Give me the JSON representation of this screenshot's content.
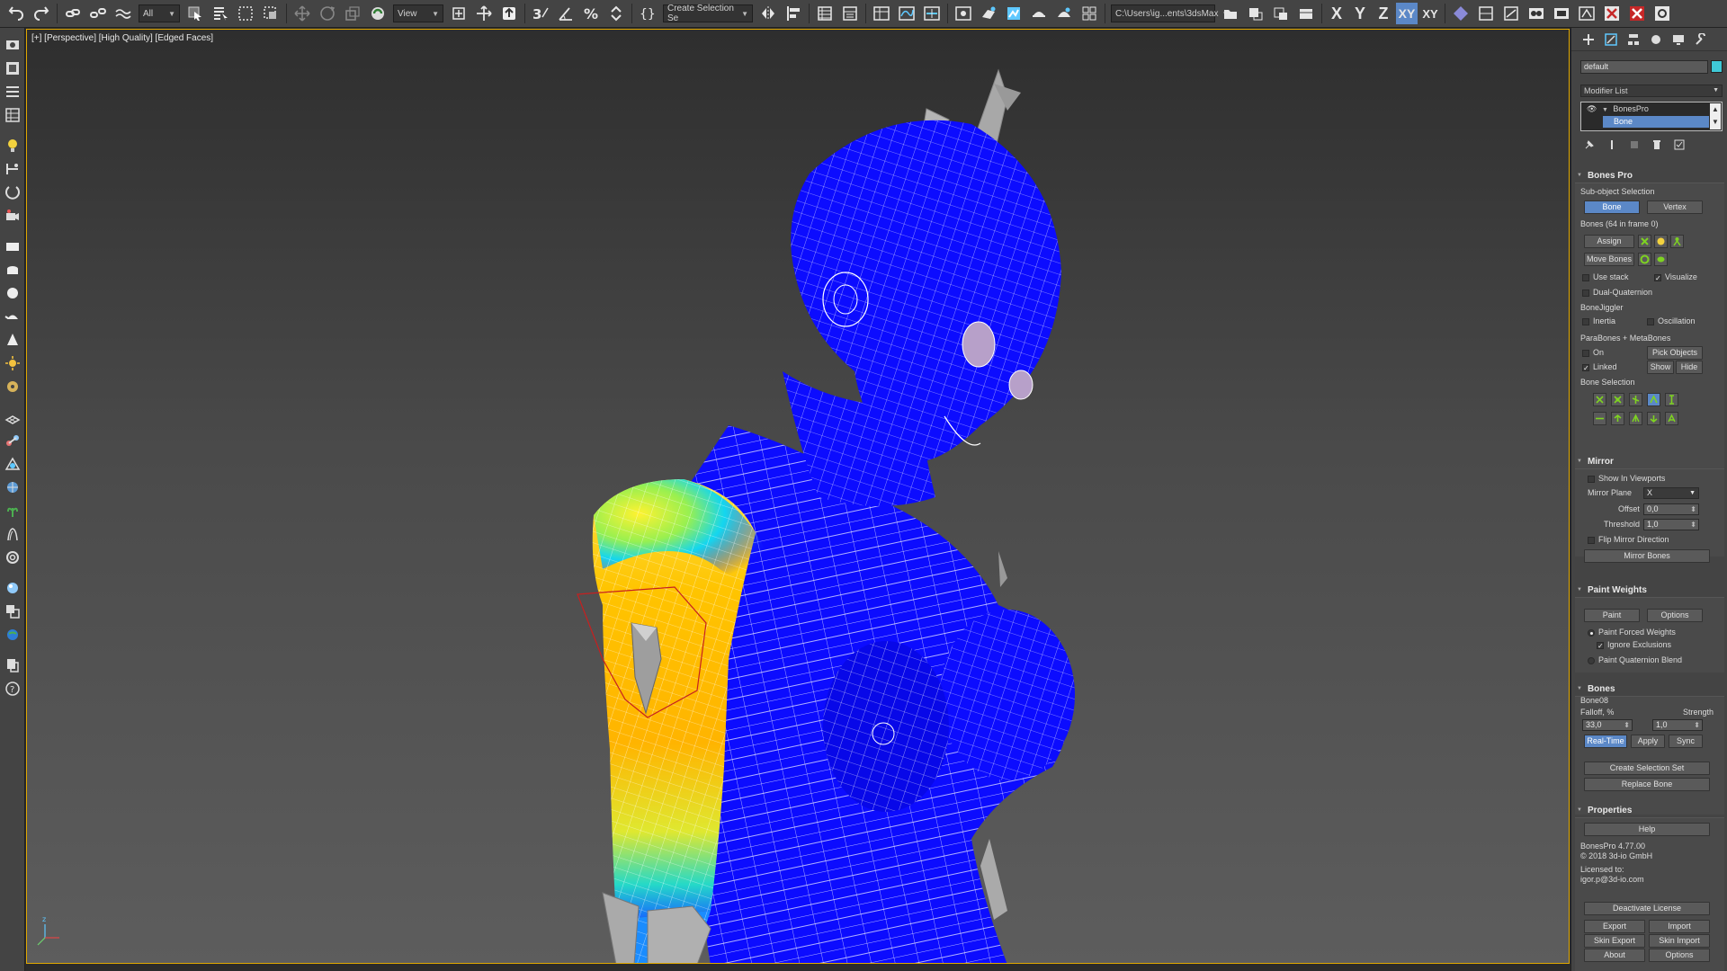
{
  "toolbar": {
    "selection_filter": "All",
    "ref_coord": "View",
    "named_selection": "Create Selection Se",
    "project_path": "C:\\Users\\ig...ents\\3dsMax",
    "axis_x": "X",
    "axis_y": "Y",
    "axis_z": "Z",
    "axis_xy": "XY",
    "axis_xy_cycle": "XY"
  },
  "viewport": {
    "label": "[+] [Perspective] [High Quality] [Edged Faces]",
    "axis_z": "z"
  },
  "panel": {
    "object_name": "default",
    "object_color": "#3fc9d7",
    "modifier_list": "Modifier List",
    "stack": [
      {
        "label": "BonesPro"
      },
      {
        "label": "Bone"
      }
    ],
    "bones_pro": {
      "title": "Bones Pro",
      "subobject_label": "Sub-object Selection",
      "bone_btn": "Bone",
      "vertex_btn": "Vertex",
      "bones_count": "Bones (64 in frame 0)",
      "assign_btn": "Assign",
      "move_bones_btn": "Move Bones",
      "use_stack": "Use stack",
      "visualize": "Visualize",
      "dual_quaternion": "Dual-Quaternion",
      "bonejiggler": "BoneJiggler",
      "inertia": "Inertia",
      "oscillation": "Oscillation",
      "parabones": "ParaBones + MetaBones",
      "on": "On",
      "pick_objects": "Pick Objects",
      "linked": "Linked",
      "show": "Show",
      "hide": "Hide",
      "bone_selection": "Bone Selection"
    },
    "mirror": {
      "title": "Mirror",
      "show_in_viewports": "Show In Viewports",
      "mirror_plane_label": "Mirror Plane",
      "mirror_plane_value": "X",
      "offset_label": "Offset",
      "offset_value": "0,0",
      "threshold_label": "Threshold",
      "threshold_value": "1,0",
      "flip_mirror": "Flip Mirror Direction",
      "mirror_bones_btn": "Mirror Bones"
    },
    "paint_weights": {
      "title": "Paint Weights",
      "paint_btn": "Paint",
      "options_btn": "Options",
      "paint_forced": "Paint Forced Weights",
      "ignore_exclusions": "Ignore Exclusions",
      "paint_quaternion": "Paint Quaternion Blend"
    },
    "bones": {
      "title": "Bones",
      "bone_name": "Bone08",
      "falloff_label": "Falloff, %",
      "strength_label": "Strength",
      "falloff_value": "33,0",
      "strength_value": "1,0",
      "realtime_btn": "Real-Time",
      "apply_btn": "Apply",
      "sync_btn": "Sync",
      "create_selection_set_btn": "Create Selection Set",
      "replace_bone_btn": "Replace Bone"
    },
    "properties": {
      "title": "Properties",
      "help_btn": "Help",
      "version": "BonesPro 4.77.00",
      "copyright": "© 2018 3d-io GmbH",
      "licensed_to": "Licensed to:",
      "licensee": "igor.p@3d-io.com",
      "deactivate_btn": "Deactivate License",
      "export_btn": "Export",
      "import_btn": "Import",
      "skin_export_btn": "Skin Export",
      "skin_import_btn": "Skin Import",
      "about_btn": "About",
      "options_btn": "Options"
    }
  }
}
